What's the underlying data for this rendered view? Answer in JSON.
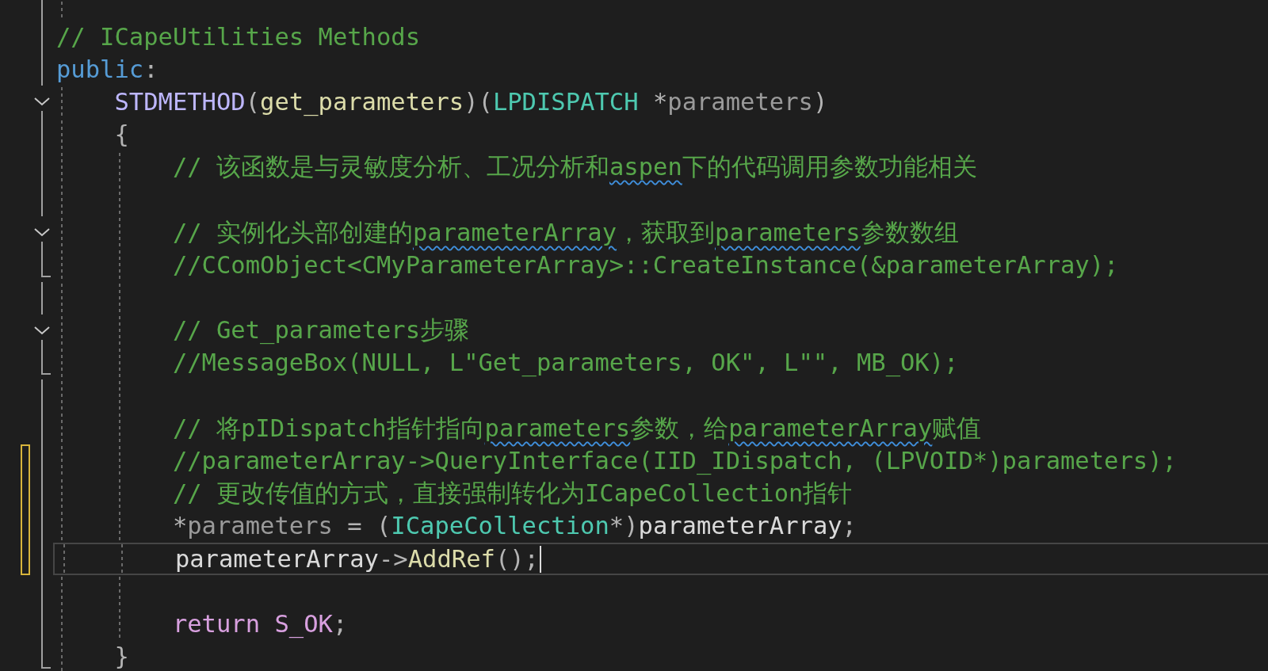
{
  "editor": {
    "lines": [
      {
        "kind": "plain",
        "tokens": [
          {
            "kind": "comment",
            "text": "// ICapeUtilities Methods"
          }
        ]
      },
      {
        "kind": "plain",
        "tokens": [
          {
            "kind": "keyword",
            "text": "public"
          },
          {
            "kind": "punct",
            "text": ":"
          }
        ],
        "children": [
          {
            "kind": "fold-start",
            "tokens": [
              {
                "kind": "macro",
                "text": "STDMETHOD"
              },
              {
                "kind": "punct",
                "text": "("
              },
              {
                "kind": "function",
                "text": "get_parameters"
              },
              {
                "kind": "punct",
                "text": ")("
              },
              {
                "kind": "type",
                "text": "LPDISPATCH"
              },
              {
                "kind": "punct",
                "text": " *"
              },
              {
                "kind": "param",
                "text": "parameters"
              },
              {
                "kind": "punct",
                "text": ")"
              }
            ]
          },
          {
            "kind": "plain",
            "tokens": [
              {
                "kind": "punct",
                "text": "{"
              }
            ],
            "children": [
              {
                "kind": "plain",
                "tokens": [
                  {
                    "kind": "comment",
                    "text": "// 该函数是与灵敏度分析、工况分析和"
                  },
                  {
                    "kind": "comment",
                    "text": "aspen",
                    "squiggle": true
                  },
                  {
                    "kind": "comment",
                    "text": "下的代码调用参数功能相关"
                  }
                ]
              },
              {
                "kind": "plain"
              },
              {
                "kind": "fold-start",
                "tokens": [
                  {
                    "kind": "comment",
                    "text": "// 实例化头部创建的"
                  },
                  {
                    "kind": "comment",
                    "text": "parameterArray",
                    "squiggle": true
                  },
                  {
                    "kind": "comment",
                    "text": "，获取到"
                  },
                  {
                    "kind": "comment",
                    "text": "parameters",
                    "squiggle": true
                  },
                  {
                    "kind": "comment",
                    "text": "参数数组"
                  }
                ]
              },
              {
                "kind": "fold-end",
                "tokens": [
                  {
                    "kind": "comment",
                    "text": "//CComObject<CMyParameterArray>::CreateInstance(&parameterArray);"
                  }
                ]
              },
              {
                "kind": "plain"
              },
              {
                "kind": "fold-start",
                "tokens": [
                  {
                    "kind": "comment",
                    "text": "// Get_parameters步骤"
                  }
                ]
              },
              {
                "kind": "fold-end",
                "tokens": [
                  {
                    "kind": "comment",
                    "text": "//MessageBox(NULL, L\"Get_parameters, OK\", L\"\", MB_OK);"
                  }
                ]
              },
              {
                "kind": "plain"
              },
              {
                "kind": "plain",
                "tokens": [
                  {
                    "kind": "comment",
                    "text": "// 将pIDispatch指针指向"
                  },
                  {
                    "kind": "comment",
                    "text": "parameters",
                    "squiggle": true
                  },
                  {
                    "kind": "comment",
                    "text": "参数，给"
                  },
                  {
                    "kind": "comment",
                    "text": "parameterArray",
                    "squiggle": true
                  },
                  {
                    "kind": "comment",
                    "text": "赋值"
                  }
                ]
              },
              {
                "kind": "plain",
                "modified": true,
                "tokens": [
                  {
                    "kind": "comment",
                    "text": "//parameterArray->QueryInterface(IID_IDispatch, (LPVOID*)parameters);"
                  }
                ]
              },
              {
                "kind": "plain",
                "modified": true,
                "tokens": [
                  {
                    "kind": "comment",
                    "text": "// 更改传值的方式，直接强制转化为ICapeCollection指针"
                  }
                ]
              },
              {
                "kind": "plain",
                "modified": true,
                "tokens": [
                  {
                    "kind": "punct",
                    "text": "*"
                  },
                  {
                    "kind": "param",
                    "text": "parameters"
                  },
                  {
                    "kind": "punct",
                    "text": " = ("
                  },
                  {
                    "kind": "type",
                    "text": "ICapeCollection"
                  },
                  {
                    "kind": "punct",
                    "text": "*)"
                  },
                  {
                    "kind": "variable",
                    "text": "parameterArray"
                  },
                  {
                    "kind": "punct",
                    "text": ";"
                  }
                ]
              },
              {
                "kind": "plain",
                "modified": true,
                "current": true,
                "tokens": [
                  {
                    "kind": "variable",
                    "text": "parameterArray"
                  },
                  {
                    "kind": "punct",
                    "text": "->"
                  },
                  {
                    "kind": "function",
                    "text": "AddRef"
                  },
                  {
                    "kind": "punct",
                    "text": "();"
                  }
                ]
              },
              {
                "kind": "plain"
              },
              {
                "kind": "plain",
                "tokens": [
                  {
                    "kind": "control",
                    "text": "return "
                  },
                  {
                    "kind": "constant",
                    "text": "S_OK"
                  },
                  {
                    "kind": "punct",
                    "text": ";"
                  }
                ]
              }
            ]
          },
          {
            "kind": "fold-end",
            "tokens": [
              {
                "kind": "punct",
                "text": "}"
              }
            ]
          }
        ]
      }
    ]
  }
}
